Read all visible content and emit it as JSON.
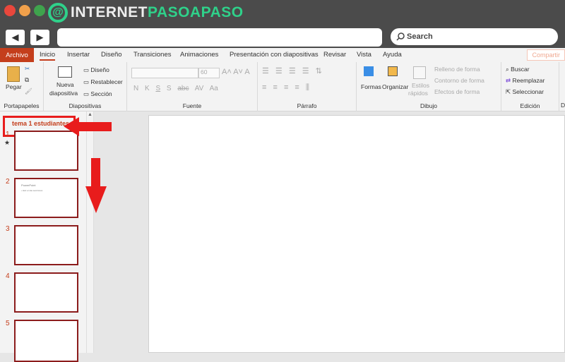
{
  "brand": {
    "logo_white": "INTERNET",
    "logo_green": "PASOAPASO",
    "logo_mark": "@"
  },
  "browser": {
    "back": "◀",
    "forward": "▶",
    "search_placeholder": "Search"
  },
  "tabs": [
    "Archivo",
    "Inicio",
    "Insertar",
    "Diseño",
    "Transiciones",
    "Animaciones",
    "Presentación con diapositivas",
    "Revisar",
    "Vista",
    "Ayuda"
  ],
  "share": "Compartir",
  "ribbon": {
    "portapapeles": {
      "label": "Portapapeles",
      "pegar": "Pegar"
    },
    "diapositivas": {
      "label": "Diapositivas",
      "nueva": "Nueva",
      "diapositiva": "diapositiva",
      "diseno": "Diseño",
      "restablecer": "Restablecer",
      "seccion": "Sección"
    },
    "fuente": {
      "label": "Fuente",
      "size": "60",
      "buttons": [
        "N",
        "K",
        "S",
        "S",
        "abc",
        "AV",
        "Aa"
      ]
    },
    "parrafo": {
      "label": "Párrafo"
    },
    "dibujo": {
      "label": "Dibujo",
      "formas": "Formas",
      "organizar": "Organizar",
      "estilos": "Estilos",
      "rapidos": "rápidos",
      "relleno": "Relleno de forma",
      "contorno": "Contorno de forma",
      "efectos": "Efectos de forma"
    },
    "edicion": {
      "label": "Edición",
      "buscar": "Buscar",
      "reemplazar": "Reemplazar",
      "seleccionar": "Seleccionar"
    },
    "cut_label": "Di"
  },
  "slides_panel": {
    "section": "tema 1 estudiantes",
    "slides": [
      "1",
      "2",
      "3",
      "4",
      "5"
    ],
    "slide2_title": "PowerPoint",
    "slide2_bullet": "• Haz en las secciones",
    "star": "★"
  },
  "colors": {
    "accent": "#c43e1c",
    "annot": "#e81c1c",
    "logo_green": "#2fd18a"
  }
}
